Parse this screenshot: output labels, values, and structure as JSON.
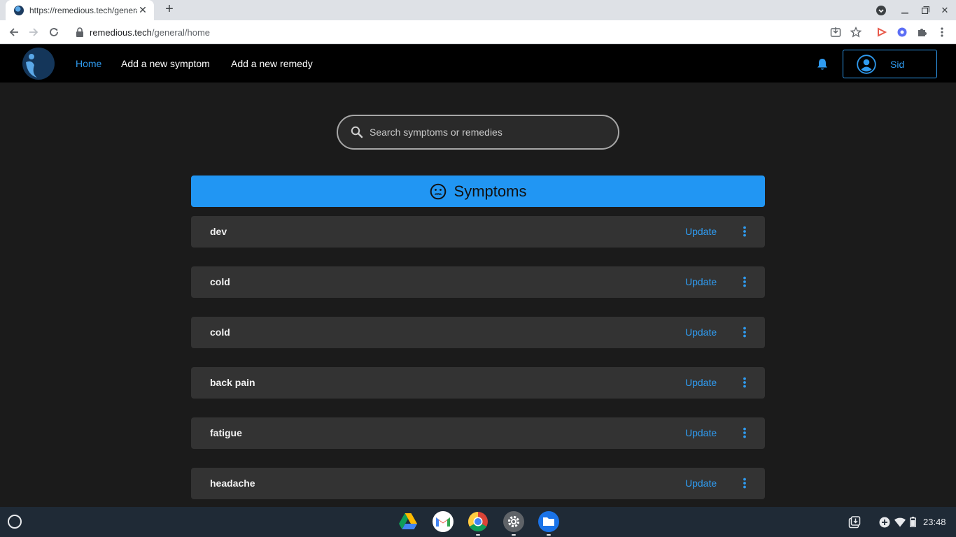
{
  "browser": {
    "tab_title": "https://remedious.tech/general/h",
    "url_host": "remedious.tech",
    "url_path": "/general/home"
  },
  "site": {
    "nav": {
      "home": "Home",
      "add_symptom": "Add a new symptom",
      "add_remedy": "Add a new remedy"
    },
    "user_name": "Sid",
    "search_placeholder": "Search symptoms or remedies",
    "symptoms_heading": "Symptoms",
    "update_label": "Update",
    "symptoms": [
      {
        "name": "dev"
      },
      {
        "name": "cold"
      },
      {
        "name": "cold"
      },
      {
        "name": "back pain"
      },
      {
        "name": "fatigue"
      },
      {
        "name": "headache"
      }
    ]
  },
  "shelf": {
    "apps": [
      "google-drive",
      "gmail",
      "chrome",
      "settings",
      "files"
    ],
    "time": "23:48"
  },
  "colors": {
    "accent": "#2196f3",
    "link": "#2f9bf0",
    "row_bg": "#333333",
    "page_bg": "#1b1b1b"
  }
}
